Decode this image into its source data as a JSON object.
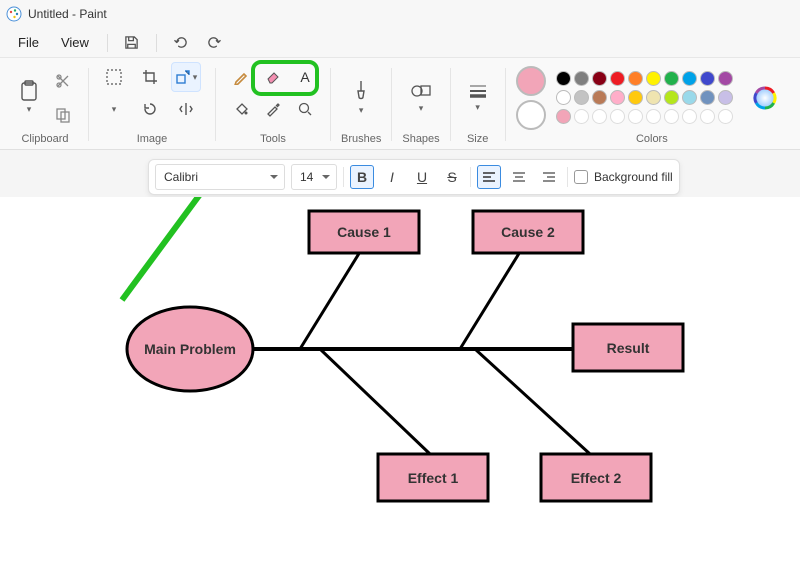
{
  "title": "Untitled - Paint",
  "menu": {
    "file": "File",
    "view": "View"
  },
  "ribbon": {
    "clipboard": "Clipboard",
    "image": "Image",
    "tools": "Tools",
    "brushes": "Brushes",
    "shapes": "Shapes",
    "size": "Size",
    "colors": "Colors"
  },
  "text_toolbar": {
    "font": "Calibri",
    "size": "14",
    "background_fill": "Background fill"
  },
  "palette": {
    "selected": "#f2a5b8",
    "row1": [
      "#000000",
      "#7f7f7f",
      "#880015",
      "#ed1c24",
      "#ff7f27",
      "#fff200",
      "#22b14c",
      "#00a2e8",
      "#3f48cc",
      "#a349a4"
    ],
    "row2": [
      "#ffffff",
      "#c3c3c3",
      "#b97a57",
      "#ffaec9",
      "#ffc90e",
      "#efe4b0",
      "#b5e61d",
      "#99d9ea",
      "#7092be",
      "#c8bfe7"
    ],
    "row3": [
      "#f2a5b8",
      "",
      "",
      "",
      "",
      "",
      "",
      "",
      "",
      ""
    ]
  },
  "diagram": {
    "main": "Main Problem",
    "cause1": "Cause 1",
    "cause2": "Cause 2",
    "effect1": "Effect 1",
    "effect2": "Effect 2",
    "result": "Result"
  }
}
